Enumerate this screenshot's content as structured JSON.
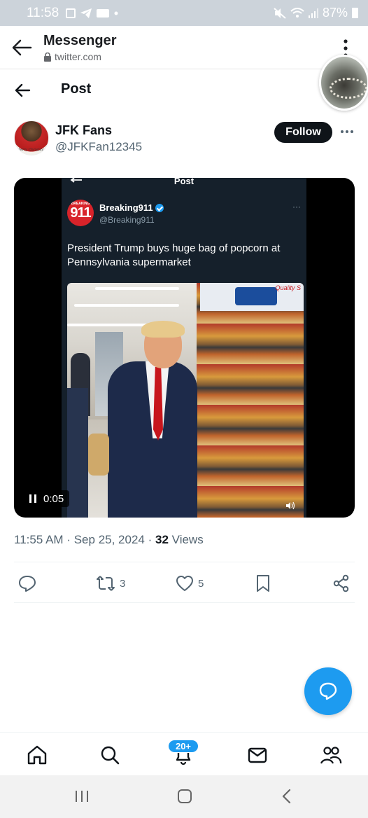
{
  "status_bar": {
    "time": "11:58",
    "battery": "87%",
    "icons": [
      "check-square-icon",
      "telegram-icon",
      "message-icon",
      "dot-icon",
      "mute-icon",
      "wifi-icon",
      "signal-icon",
      "battery-icon"
    ]
  },
  "browser_bar": {
    "title": "Messenger",
    "domain": "twitter.com",
    "icons": [
      "back-arrow-icon",
      "lock-icon",
      "kebab-menu-icon"
    ]
  },
  "post_header": {
    "title": "Post"
  },
  "author": {
    "name": "JFK Fans",
    "handle": "@JFKFan12345",
    "avatar_caption": "Merry Christmas",
    "follow_label": "Follow"
  },
  "embedded_post": {
    "screen_title": "Post",
    "name": "Breaking911",
    "handle": "@Breaking911",
    "avatar_text": "911",
    "avatar_small_text": "BREAKING",
    "text": "President Trump buys huge bag of popcorn at Pennsylvania supermarket",
    "sign_text": "Quality S"
  },
  "video": {
    "time": "0:05",
    "state": "playing"
  },
  "meta": {
    "time": "11:55 AM",
    "sep": "·",
    "date": "Sep 25, 2024",
    "views_count": "32",
    "views_label": "Views"
  },
  "actions": {
    "reply_count": "",
    "retweet_count": "3",
    "like_count": "5"
  },
  "bottom_nav": {
    "notif_badge": "20+",
    "items": [
      "home-icon",
      "search-icon",
      "bell-icon",
      "mail-icon",
      "communities-icon"
    ]
  },
  "colors": {
    "accent": "#1d9bf0",
    "text": "#0f1419",
    "secondary": "#536471",
    "tie_red": "#c7161d"
  }
}
